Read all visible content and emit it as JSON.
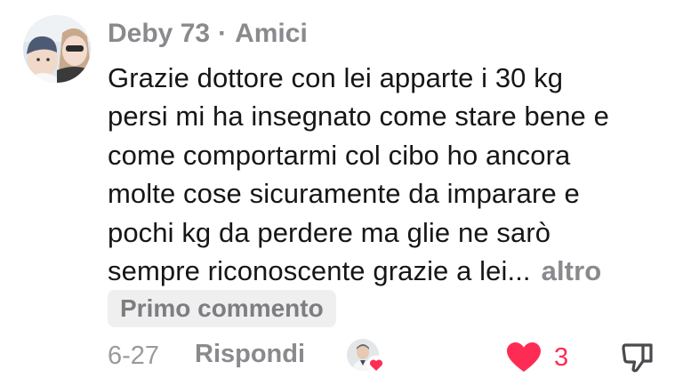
{
  "comment": {
    "author": "Deby 73",
    "separator": "·",
    "relation": "Amici",
    "text_lines": [
      "Grazie dottore con lei apparte i 30 kg",
      "persi mi ha insegnato come stare bene e",
      "come comportarmi col cibo ho ancora",
      "molte cose sicuramente da imparare e",
      "pochi kg da perdere ma glie ne sarò",
      "sempre riconoscente grazie a lei..."
    ],
    "more_label": "altro",
    "badge": "Primo commento",
    "date": "6-27",
    "reply_label": "Rispondi",
    "like_count": "3",
    "liked_by_creator": true
  },
  "icons": {
    "avatar": "user-avatar-photo",
    "creator_avatar": "creator-avatar-photo",
    "creator_heart": "heart-badge-icon",
    "like": "heart-filled-icon",
    "dislike": "thumbs-down-icon"
  },
  "colors": {
    "like": "#fe2c55",
    "muted": "#8a8a8e",
    "text": "#161616",
    "badge_bg": "#efefef"
  }
}
